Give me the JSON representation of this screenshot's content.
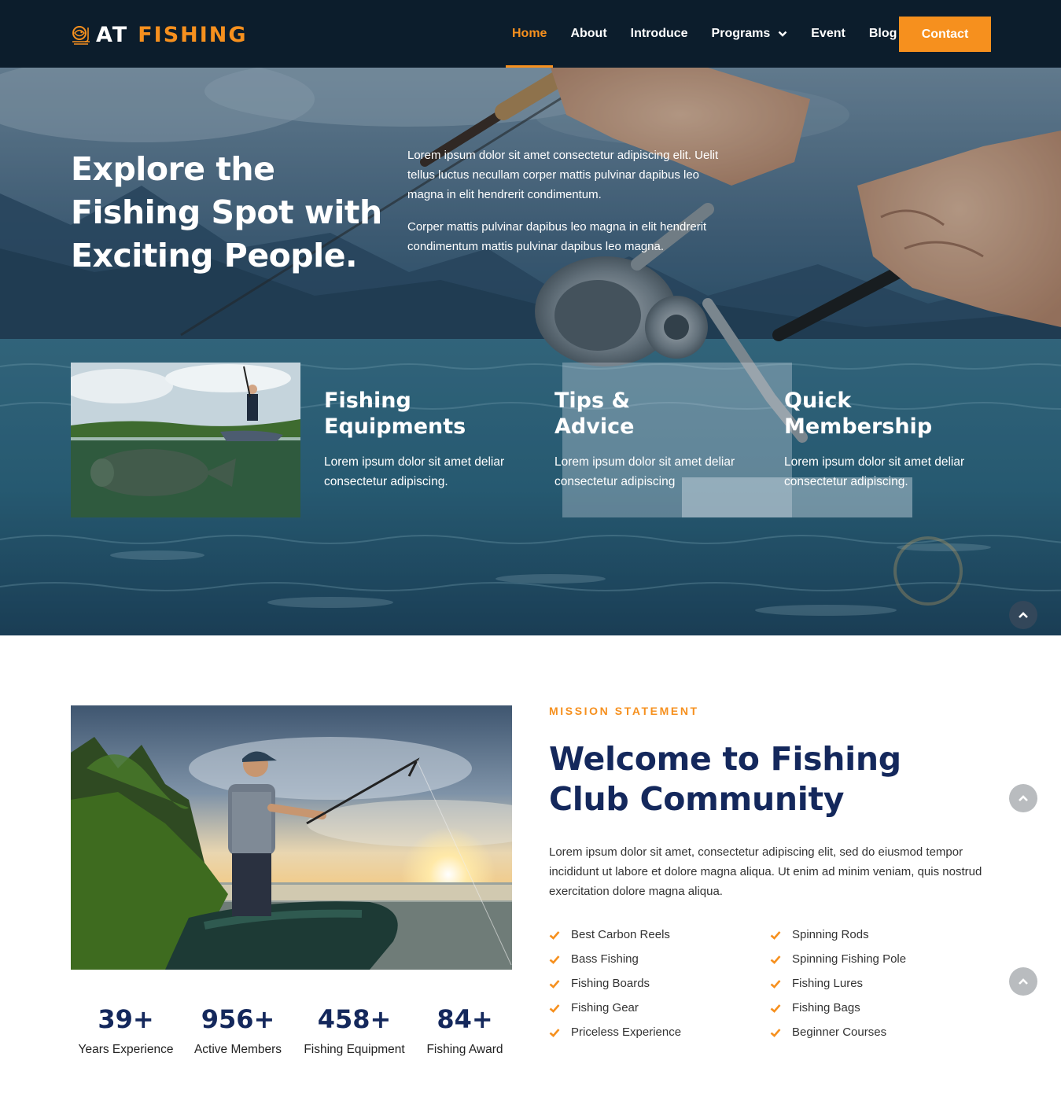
{
  "brand": {
    "name_part1": "AT",
    "name_part2": "FISHING"
  },
  "nav": {
    "items": [
      {
        "label": "Home",
        "active": true
      },
      {
        "label": "About"
      },
      {
        "label": "Introduce"
      },
      {
        "label": "Programs",
        "has_dropdown": true
      },
      {
        "label": "Event"
      },
      {
        "label": "Blog"
      }
    ],
    "contact_label": "Contact"
  },
  "hero": {
    "title": "Explore the Fishing Spot with Exciting People.",
    "paragraph1": "Lorem ipsum dolor sit amet consectetur adipiscing elit. Uelit tellus luctus necullam corper mattis pulvinar dapibus leo magna in elit hendrerit condimentum.",
    "paragraph2": "Corper mattis pulvinar dapibus leo magna in elit hendrerit condimentum mattis pulvinar dapibus leo magna."
  },
  "features": [
    {
      "title": "Fishing Equipments",
      "text": "Lorem ipsum dolor sit amet deliar consectetur adipiscing."
    },
    {
      "title": "Tips & Advice",
      "text": "Lorem ipsum dolor sit amet deliar consectetur adipiscing"
    },
    {
      "title": "Quick Membership",
      "text": "Lorem ipsum dolor sit amet deliar consectetur adipiscing."
    }
  ],
  "mission": {
    "kicker": "MISSION STATEMENT",
    "title": "Welcome to Fishing Club Community",
    "body": "Lorem ipsum dolor sit amet, consectetur adipiscing elit, sed do eiusmod tempor incididunt ut labore et dolore magna aliqua. Ut enim ad minim veniam, quis nostrud exercitation dolore magna aliqua.",
    "list_left": [
      "Best Carbon Reels",
      "Bass Fishing",
      "Fishing Boards",
      "Fishing Gear",
      "Priceless Experience"
    ],
    "list_right": [
      "Spinning Rods",
      "Spinning Fishing Pole",
      "Fishing Lures",
      "Fishing Bags",
      "Beginner Courses"
    ]
  },
  "stats": [
    {
      "value": "39+",
      "label": "Years Experience"
    },
    {
      "value": "956+",
      "label": "Active Members"
    },
    {
      "value": "458+",
      "label": "Fishing Equipment"
    },
    {
      "value": "84+",
      "label": "Fishing Award"
    }
  ],
  "colors": {
    "accent": "#f6901e",
    "navy": "#14285c",
    "header_bg": "#0c1d2c"
  },
  "icons": {
    "scroll_top": "chevron-up-icon",
    "list_bullet": "check-icon",
    "dropdown": "chevron-down-icon"
  }
}
